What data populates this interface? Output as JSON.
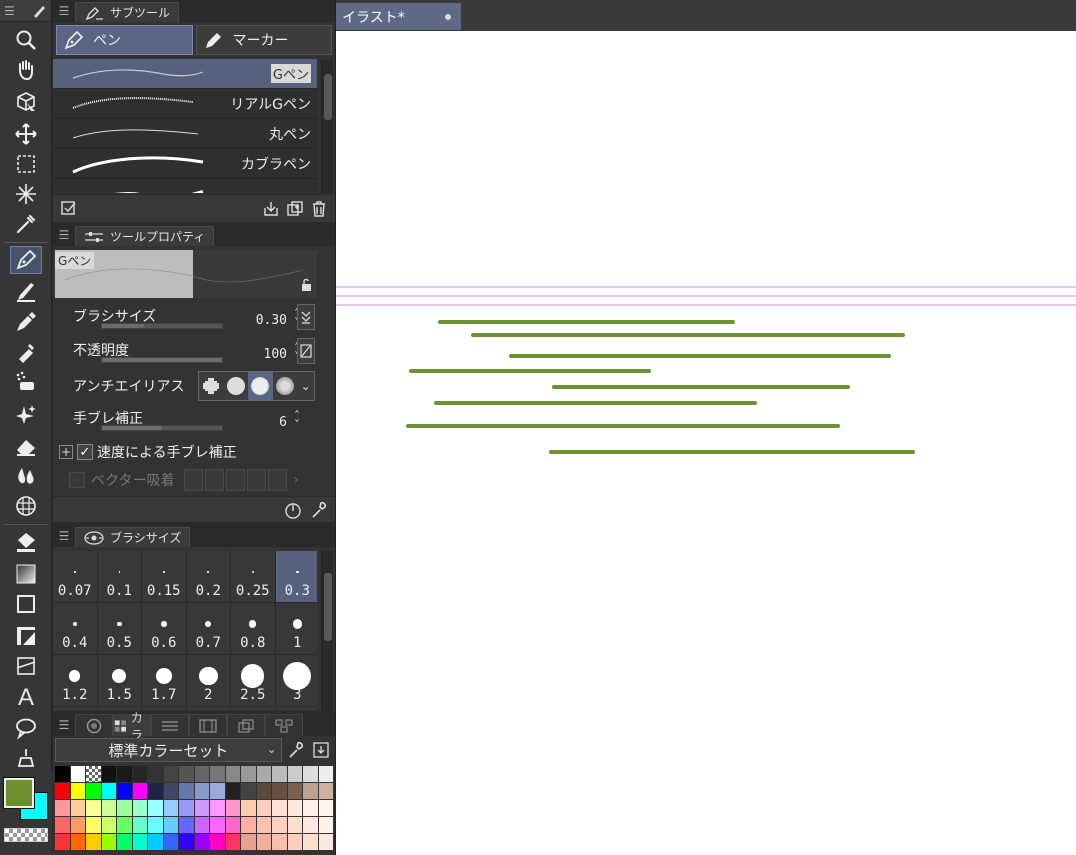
{
  "colors": {
    "accent": "#5a6585",
    "stroke_green": "#6c9331",
    "guide_purple": "#c78fd8",
    "main_color": "#6e8f2e",
    "sub_color": "#00ffff"
  },
  "subtool": {
    "tab_label": "サブツール",
    "groups": [
      {
        "label": "ペン",
        "active": true,
        "icon": "pen-nib-icon"
      },
      {
        "label": "マーカー",
        "active": false,
        "icon": "marker-icon"
      }
    ],
    "brushes": [
      {
        "name": "Gペン",
        "active": true
      },
      {
        "name": "リアルGペン",
        "active": false
      },
      {
        "name": "丸ペン",
        "active": false
      },
      {
        "name": "カブラペン",
        "active": false
      },
      {
        "name": "",
        "active": false
      }
    ]
  },
  "tool_property": {
    "tab_label": "ツールプロパティ",
    "preview_name": "Gペン",
    "brush_size": {
      "label": "ブラシサイズ",
      "value": "0.30",
      "fill": 0.35
    },
    "opacity": {
      "label": "不透明度",
      "value": "100",
      "fill": 1.0
    },
    "antialias": {
      "label": "アンチエイリアス"
    },
    "stabilization": {
      "label": "手ブレ補正",
      "value": "6",
      "fill": 0.5
    },
    "speed_stabilization": {
      "label": "速度による手ブレ補正",
      "checked": true
    },
    "vector_snap": {
      "label": "ベクター吸着"
    }
  },
  "brush_size_palette": {
    "tab_label": "ブラシサイズ",
    "sizes": [
      "0.07",
      "0.1",
      "0.15",
      "0.2",
      "0.25",
      "0.3",
      "0.4",
      "0.5",
      "0.6",
      "0.7",
      "0.8",
      "1",
      "1.2",
      "1.5",
      "1.7",
      "2",
      "2.5",
      "3",
      "",
      "",
      "",
      "",
      "",
      ""
    ],
    "selected": "0.3"
  },
  "color_set": {
    "tab_label": "カラ",
    "set_name": "標準カラーセット"
  },
  "document": {
    "tab_title": "イラスト*"
  }
}
